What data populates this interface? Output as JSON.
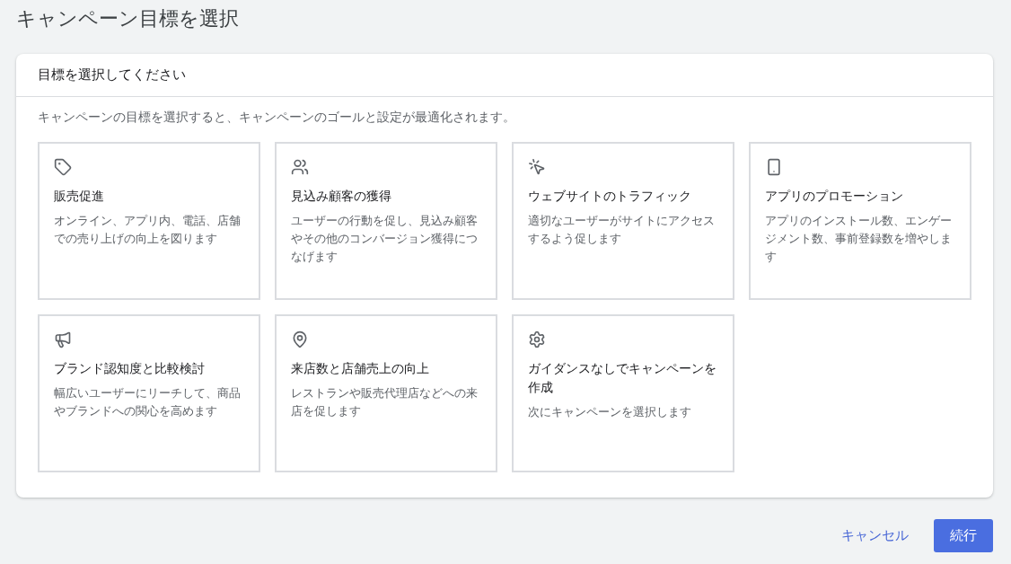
{
  "page_title": "キャンペーン目標を選択",
  "panel": {
    "title": "目標を選択してください",
    "description": "キャンペーンの目標を選択すると、キャンペーンのゴールと設定が最適化されます。",
    "goals": [
      {
        "kind": "tag",
        "title": "販売促進",
        "description": "オンライン、アプリ内、電話、店舗での売り上げの向上を図ります"
      },
      {
        "kind": "people",
        "title": "見込み顧客の獲得",
        "description": "ユーザーの行動を促し、見込み顧客やその他のコンバージョン獲得につなげます"
      },
      {
        "kind": "click",
        "title": "ウェブサイトのトラフィック",
        "description": "適切なユーザーがサイトにアクセスするよう促します"
      },
      {
        "kind": "phone",
        "title": "アプリのプロモーション",
        "description": "アプリのインストール数、エンゲージメント数、事前登録数を増やします"
      },
      {
        "kind": "megaphone",
        "title": "ブランド認知度と比較検討",
        "description": "幅広いユーザーにリーチして、商品やブランドへの関心を高めます"
      },
      {
        "kind": "pin",
        "title": "来店数と店舗売上の向上",
        "description": "レストランや販売代理店などへの来店を促します"
      },
      {
        "kind": "gear",
        "title": "ガイダンスなしでキャンペーンを作成",
        "description": "次にキャンペーンを選択します"
      }
    ]
  },
  "footer": {
    "cancel": "キャンセル",
    "continue": "続行"
  }
}
